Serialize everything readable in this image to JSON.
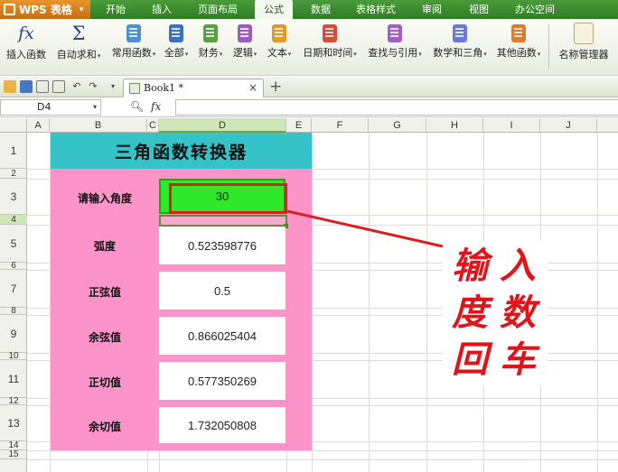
{
  "menubar": {
    "app_label": "WPS 表格",
    "items": [
      "开始",
      "插入",
      "页面布局",
      "公式",
      "数据",
      "表格样式",
      "审阅",
      "视图",
      "办公空间"
    ],
    "active_index": 3
  },
  "ribbon": {
    "buttons": [
      {
        "label": "插入函数",
        "icon": "fx-icon"
      },
      {
        "label": "自动求和",
        "icon": "sigma-icon"
      },
      {
        "label": "常用函数",
        "icon": "book-icon",
        "color": "#4a8fd8"
      },
      {
        "label": "全部",
        "icon": "book-icon",
        "color": "#3b6fc0"
      },
      {
        "label": "财务",
        "icon": "book-icon",
        "color": "#5aa042"
      },
      {
        "label": "逻辑",
        "icon": "book-icon",
        "color": "#9a5cc4"
      },
      {
        "label": "文本",
        "icon": "book-icon",
        "color": "#e8962a"
      },
      {
        "label": "日期和时间",
        "icon": "book-icon",
        "color": "#d94a3a"
      },
      {
        "label": "查找与引用",
        "icon": "book-icon",
        "color": "#a060c8"
      },
      {
        "label": "数学和三角",
        "icon": "book-icon",
        "color": "#6a78d8"
      },
      {
        "label": "其他函数",
        "icon": "book-icon",
        "color": "#e07a30"
      },
      {
        "label": "名称管理器",
        "icon": "notes-icon"
      }
    ]
  },
  "tabs": {
    "doc_name": "Book1 *",
    "close_glyph": "×",
    "new_glyph": "+"
  },
  "formula_bar": {
    "cell_ref": "D4",
    "fx_label": "fx",
    "value": ""
  },
  "sheet": {
    "columns": [
      "A",
      "B",
      "C",
      "D",
      "E",
      "F",
      "G",
      "H",
      "I",
      "J"
    ],
    "selected_column": "D",
    "rows": [
      "1",
      "2",
      "3",
      "4",
      "5",
      "6",
      "7",
      "8",
      "9",
      "10",
      "11",
      "12",
      "13",
      "14",
      "15"
    ],
    "selected_row": "4"
  },
  "converter": {
    "title": "三角函数转换器",
    "input_label": "请输入角度",
    "input_value": "30",
    "rows": [
      {
        "label": "弧度",
        "value": "0.523598776"
      },
      {
        "label": "正弦值",
        "value": "0.5"
      },
      {
        "label": "余弦值",
        "value": "0.866025404"
      },
      {
        "label": "正切值",
        "value": "0.577350269"
      },
      {
        "label": "余切值",
        "value": "1.732050808"
      }
    ],
    "fill_colors": {
      "title": "#35c3c7",
      "body": "#fc94c9",
      "input": "#2ee82a"
    }
  },
  "annotation": {
    "chars": [
      "输",
      "入",
      "度",
      "数",
      "回",
      "车"
    ],
    "color": "#e1141c"
  }
}
